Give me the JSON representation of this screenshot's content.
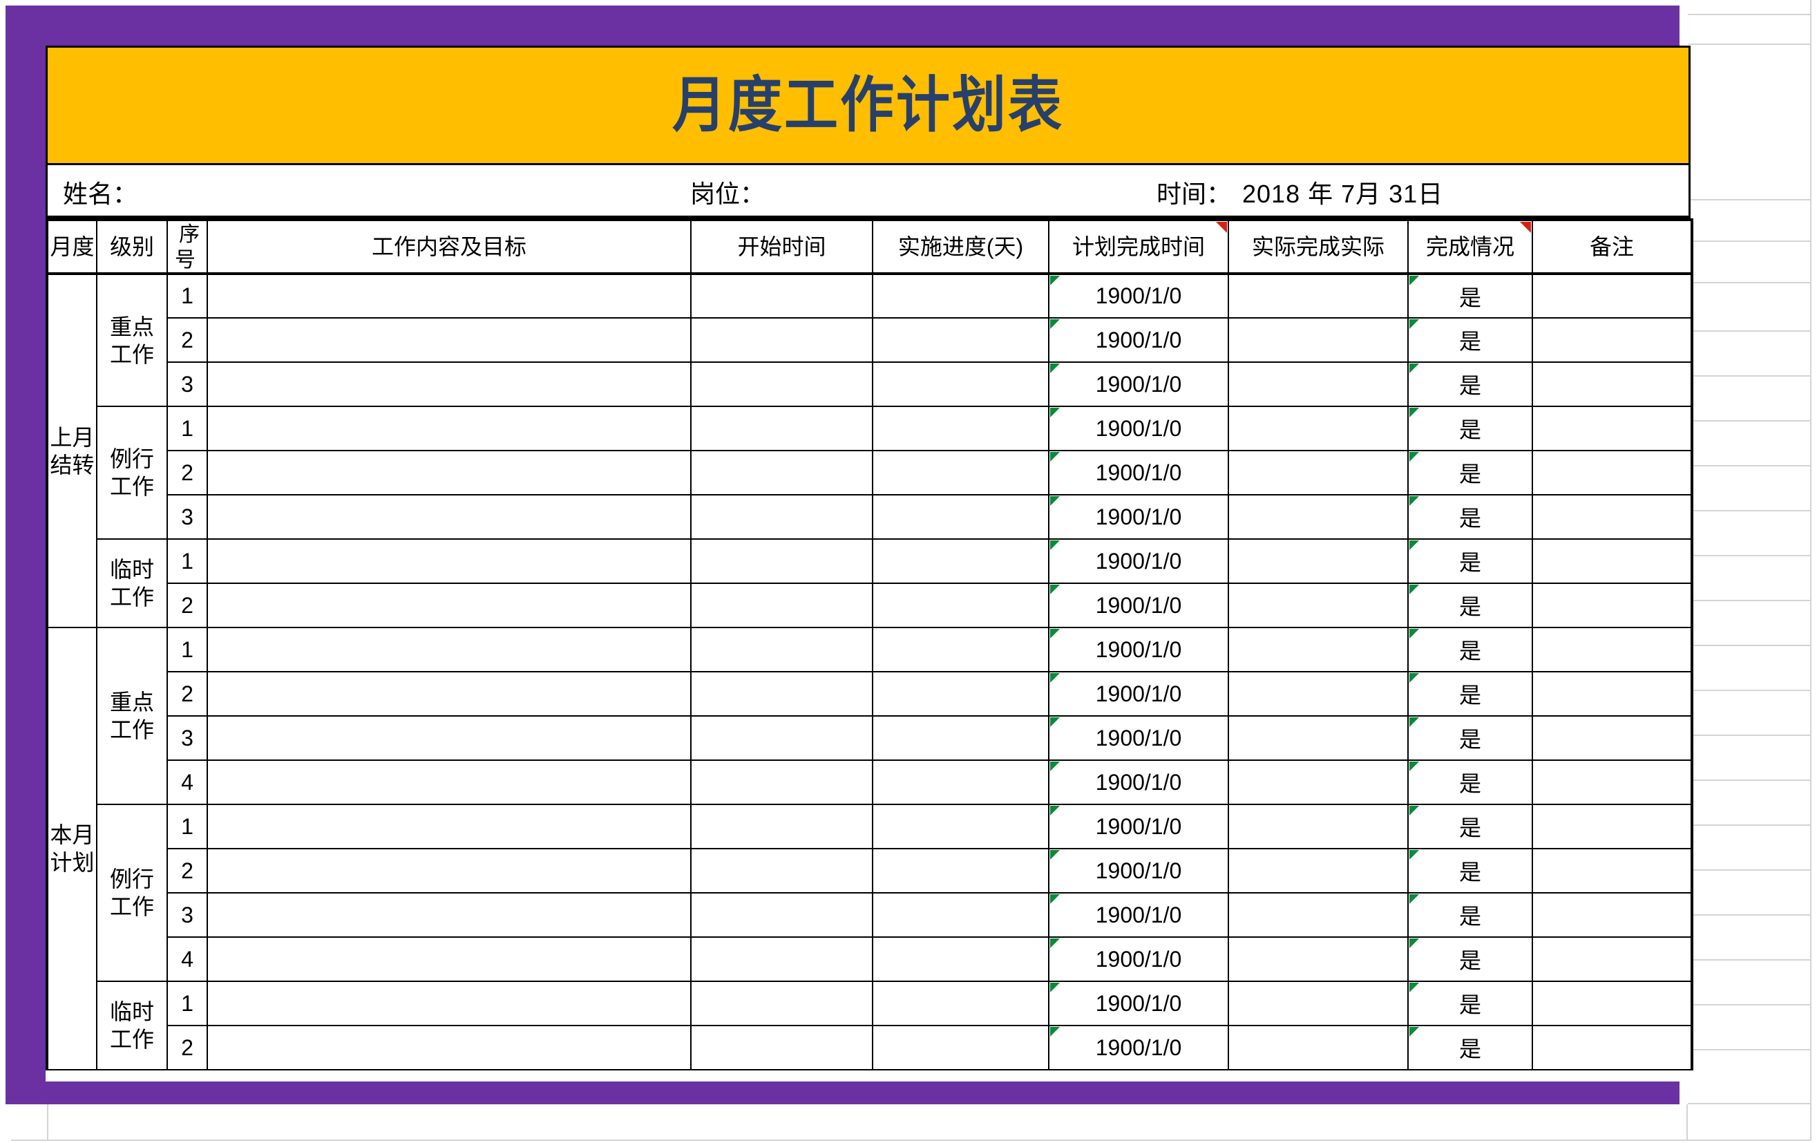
{
  "colors": {
    "frame_purple": "#6B31A3",
    "title_bg": "#FFBE00",
    "title_fg": "#27406B",
    "grid_line": "#d4d4d4",
    "comment_marker": "#D8200F",
    "error_marker": "#0B8A3C"
  },
  "title": "月度工作计划表",
  "info": {
    "name_label": "姓名：",
    "position_label": "岗位：",
    "time_label": "时间：",
    "time_value": "2018 年 7月 31日"
  },
  "table": {
    "headers": [
      {
        "label": "月度",
        "comment": false
      },
      {
        "label": "级别",
        "comment": false
      },
      {
        "label": "序号",
        "comment": false
      },
      {
        "label": "工作内容及目标",
        "comment": false
      },
      {
        "label": "开始时间",
        "comment": false
      },
      {
        "label": "实施进度(天)",
        "comment": false
      },
      {
        "label": "计划完成时间",
        "comment": true
      },
      {
        "label": "实际完成实际",
        "comment": false
      },
      {
        "label": "完成情况",
        "comment": true
      },
      {
        "label": "备注",
        "comment": false
      }
    ],
    "default_plan_date": "1900/1/0",
    "default_status": "是",
    "groups": [
      {
        "month": "上月结转",
        "levels": [
          {
            "level": "重点工作",
            "seq": [
              "1",
              "2",
              "3"
            ]
          },
          {
            "level": "例行工作",
            "seq": [
              "1",
              "2",
              "3"
            ]
          },
          {
            "level": "临时工作",
            "seq": [
              "1",
              "2"
            ]
          }
        ]
      },
      {
        "month": "本月计划",
        "levels": [
          {
            "level": "重点工作",
            "seq": [
              "1",
              "2",
              "3",
              "4"
            ]
          },
          {
            "level": "例行工作",
            "seq": [
              "1",
              "2",
              "3",
              "4"
            ]
          },
          {
            "level": "临时工作",
            "seq": [
              "1",
              "2"
            ]
          }
        ]
      }
    ]
  }
}
